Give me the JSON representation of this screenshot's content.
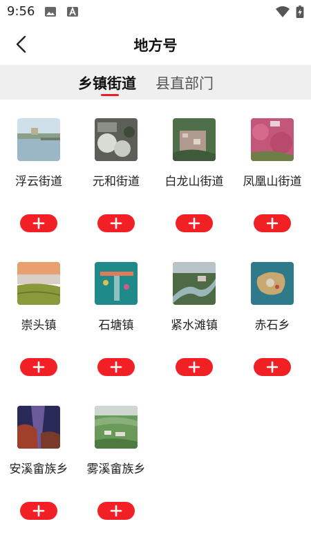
{
  "status": {
    "time": "9:56",
    "icons": [
      "image-icon",
      "a-icon",
      "wifi-icon",
      "battery-charging-icon"
    ]
  },
  "header": {
    "title": "地方号",
    "back_icon": "chevron-left-icon"
  },
  "tabs": [
    {
      "label": "乡镇街道",
      "active": true
    },
    {
      "label": "县直部门",
      "active": false
    }
  ],
  "accent_color": "#e8202a",
  "items": [
    {
      "name": "浮云街道",
      "add_icon": "plus-icon"
    },
    {
      "name": "元和街道",
      "add_icon": "plus-icon"
    },
    {
      "name": "白龙山街道",
      "add_icon": "plus-icon"
    },
    {
      "name": "凤凰山街道",
      "add_icon": "plus-icon"
    },
    {
      "name": "崇头镇",
      "add_icon": "plus-icon"
    },
    {
      "name": "石塘镇",
      "add_icon": "plus-icon"
    },
    {
      "name": "紧水滩镇",
      "add_icon": "plus-icon"
    },
    {
      "name": "赤石乡",
      "add_icon": "plus-icon"
    },
    {
      "name": "安溪畲族乡",
      "add_icon": "plus-icon"
    },
    {
      "name": "雾溪畲族乡",
      "add_icon": "plus-icon"
    }
  ]
}
